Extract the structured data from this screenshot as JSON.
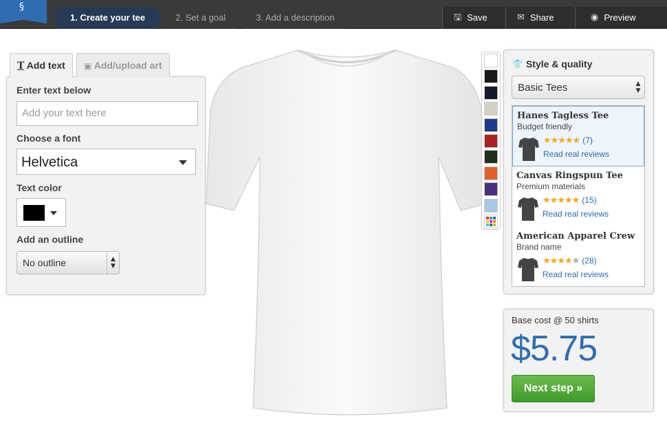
{
  "steps": [
    {
      "label": "1. Create your tee",
      "active": true
    },
    {
      "label": "2. Set a goal",
      "active": false
    },
    {
      "label": "3. Add a description",
      "active": false
    }
  ],
  "actions": {
    "save": "Save",
    "share": "Share",
    "preview": "Preview"
  },
  "tabs": {
    "add_text": "Add text",
    "add_art": "Add/upload art"
  },
  "text_panel": {
    "enter_label": "Enter text below",
    "text_placeholder": "Add your text here",
    "font_label": "Choose a font",
    "font_value": "Helvetica",
    "color_label": "Text color",
    "text_color": "#000000",
    "outline_label": "Add an outline",
    "outline_value": "No outline"
  },
  "swatch_colors": [
    "#ffffff",
    "#1a1a1a",
    "#141a2e",
    "#d2cfc4",
    "#1d3a8a",
    "#a8231f",
    "#1f2f1e",
    "#e0612a",
    "#4a2f7a",
    "#a9c8e8"
  ],
  "style_quality": {
    "title": "Style & quality",
    "selected": "Basic Tees",
    "products": [
      {
        "name": "Hanes Tagless Tee",
        "desc": "Budget friendly",
        "rating": 5,
        "count": "(7)",
        "reviews": "Read real reviews",
        "selected": true
      },
      {
        "name": "Canvas Ringspun Tee",
        "desc": "Premium materials",
        "rating": 5,
        "count": "(15)",
        "reviews": "Read real reviews",
        "selected": false
      },
      {
        "name": "American Apparel Crew",
        "desc": "Brand name",
        "rating": 4,
        "count": "(28)",
        "reviews": "Read real reviews",
        "selected": false
      }
    ]
  },
  "cost": {
    "label": "Base cost @ 50 shirts",
    "price": "$5.75",
    "next": "Next step »"
  }
}
